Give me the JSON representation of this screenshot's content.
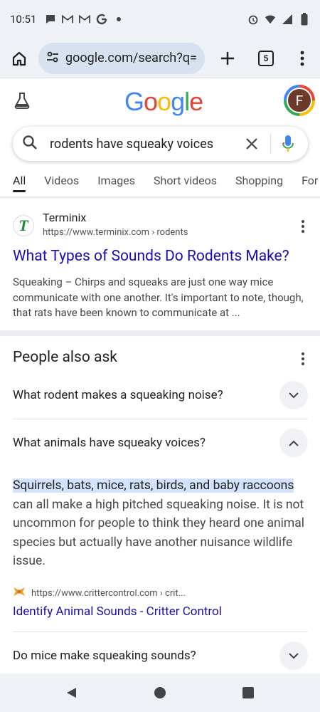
{
  "status_bar": {
    "time": "10:51",
    "left_icons": [
      "chat-bubble-icon",
      "gmail-icon",
      "gmail-icon",
      "google-icon",
      "dot-icon"
    ],
    "right_icons": [
      "alarm-icon",
      "wifi-icon",
      "signal-icon",
      "battery-icon"
    ]
  },
  "browser": {
    "url": "google.com/search?q=ro",
    "tab_count": "5"
  },
  "google": {
    "logo_letters": [
      {
        "ch": "G",
        "color": "#4285F4"
      },
      {
        "ch": "o",
        "color": "#EA4335"
      },
      {
        "ch": "o",
        "color": "#FBBC05"
      },
      {
        "ch": "g",
        "color": "#4285F4"
      },
      {
        "ch": "l",
        "color": "#34A853"
      },
      {
        "ch": "e",
        "color": "#EA4335"
      }
    ],
    "avatar_letter": "F"
  },
  "search": {
    "query": "rodents have squeaky voices"
  },
  "tabs": [
    {
      "label": "All",
      "active": true
    },
    {
      "label": "Videos",
      "active": false
    },
    {
      "label": "Images",
      "active": false
    },
    {
      "label": "Short videos",
      "active": false
    },
    {
      "label": "Shopping",
      "active": false
    },
    {
      "label": "For",
      "active": false
    }
  ],
  "result": {
    "site_name": "Terminix",
    "favicon_letter": "T",
    "url": "https://www.terminix.com › rodents",
    "title": "What Types of Sounds Do Rodents Make?",
    "snippet": "Squeaking – Chirps and squeaks are just one way mice communicate with one another. It's important to note, though, that rats have been known to communicate at ..."
  },
  "people_also_ask": {
    "title": "People also ask",
    "questions": [
      {
        "text": "What rodent makes a squeaking noise?",
        "expanded": false
      },
      {
        "text": "What animals have squeaky voices?",
        "expanded": true
      },
      {
        "text": "Do mice make squeaking sounds?",
        "expanded": false
      }
    ],
    "answer_highlight": "Squirrels, bats, mice, rats, birds, and baby raccoons",
    "answer_rest": " can all make a high pitched squeaking noise. It is not uncommon for people to think they heard one animal species but actually have another nuisance wildlife issue.",
    "source_url": "https://www.crittercontrol.com › crit...",
    "source_link": "Identify Animal Sounds - Critter Control"
  },
  "colors": {
    "link": "#1a0dab",
    "highlight": "#d3e3fd",
    "favicon_green": "#1a8a3a"
  }
}
